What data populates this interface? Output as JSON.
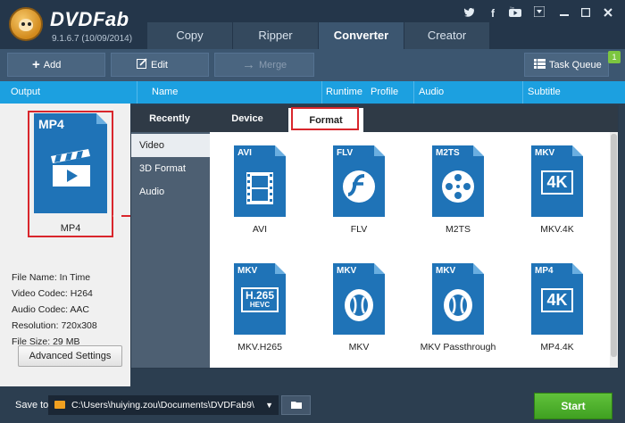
{
  "app": {
    "name": "DVDFab",
    "version": "9.1.6.7 (10/09/2014)"
  },
  "main_tabs": [
    {
      "label": "Copy",
      "active": false
    },
    {
      "label": "Ripper",
      "active": false
    },
    {
      "label": "Converter",
      "active": true
    },
    {
      "label": "Creator",
      "active": false
    }
  ],
  "window_icons": [
    "twitter-icon",
    "facebook-icon",
    "youtube-icon",
    "menu-icon",
    "minimize-icon",
    "maximize-icon",
    "close-icon"
  ],
  "toolbar": {
    "add": "Add",
    "edit": "Edit",
    "merge": "Merge",
    "task_queue": "Task Queue",
    "task_count": "1"
  },
  "columns": {
    "output": "Output",
    "name": "Name",
    "runtime": "Runtime",
    "profile": "Profile",
    "audio": "Audio",
    "subtitle": "Subtitle"
  },
  "selected_profile": {
    "format": "MP4",
    "label": "MP4"
  },
  "advanced_settings": "Advanced Settings",
  "file_info": {
    "file_name": "File Name: In Time",
    "video_codec": "Video Codec: H264",
    "audio_codec": "Audio Codec: AAC",
    "resolution": "Resolution: 720x308",
    "file_size": "File Size: 29 MB"
  },
  "popup_tabs": [
    {
      "label": "Recently",
      "active": false
    },
    {
      "label": "Device",
      "active": false
    },
    {
      "label": "Format",
      "active": true
    }
  ],
  "popup_side": [
    {
      "label": "Video",
      "active": true
    },
    {
      "label": "3D Format",
      "active": false
    },
    {
      "label": "Audio",
      "active": false
    }
  ],
  "formats": [
    {
      "tag": "AVI",
      "name": "AVI",
      "icon": "film-strip-icon"
    },
    {
      "tag": "FLV",
      "name": "FLV",
      "icon": "flash-icon"
    },
    {
      "tag": "M2TS",
      "name": "M2TS",
      "icon": "film-reel-icon"
    },
    {
      "tag": "MKV",
      "name": "MKV.4K",
      "icon": "4k-icon",
      "glyph": "4K"
    },
    {
      "tag": "MKV",
      "name": "MKV.H265",
      "icon": "h265-icon",
      "glyph": "H.265",
      "sub": "HEVC"
    },
    {
      "tag": "MKV",
      "name": "MKV",
      "icon": "mkv-logo-icon"
    },
    {
      "tag": "MKV",
      "name": "MKV Passthrough",
      "icon": "mkv-logo-icon"
    },
    {
      "tag": "MP4",
      "name": "MP4.4K",
      "icon": "4k-icon",
      "glyph": "4K"
    }
  ],
  "bottom": {
    "save_to": "Save to:",
    "path": "C:\\Users\\huiying.zou\\Documents\\DVDFab9\\",
    "start": "Start"
  },
  "colors": {
    "accent": "#1ca0e0",
    "format_blue": "#1f73b7",
    "start_green": "#4caf2e",
    "highlight_red": "#d9262c"
  }
}
